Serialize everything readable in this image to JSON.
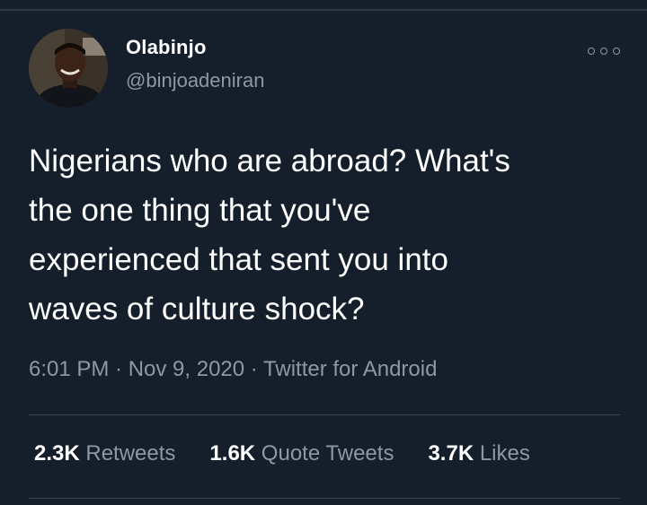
{
  "tweet": {
    "author": {
      "display_name": "Olabinjo",
      "handle": "@binjoadeniran"
    },
    "text": "Nigerians who are abroad? What's\nthe one thing that you've\nexperienced that sent you into\nwaves of culture shock?",
    "meta": "6:01 PM · Nov 9, 2020 · Twitter for Android",
    "stats": [
      {
        "count": "2.3K",
        "label": "Retweets"
      },
      {
        "count": "1.6K",
        "label": "Quote Tweets"
      },
      {
        "count": "3.7K",
        "label": "Likes"
      }
    ],
    "icons": {
      "more": "more-options-icon",
      "avatar": "avatar-image"
    }
  },
  "colors": {
    "background": "#151f2b",
    "text_primary": "#ffffff",
    "text_secondary": "#8b98a5",
    "divider": "#38444d"
  }
}
